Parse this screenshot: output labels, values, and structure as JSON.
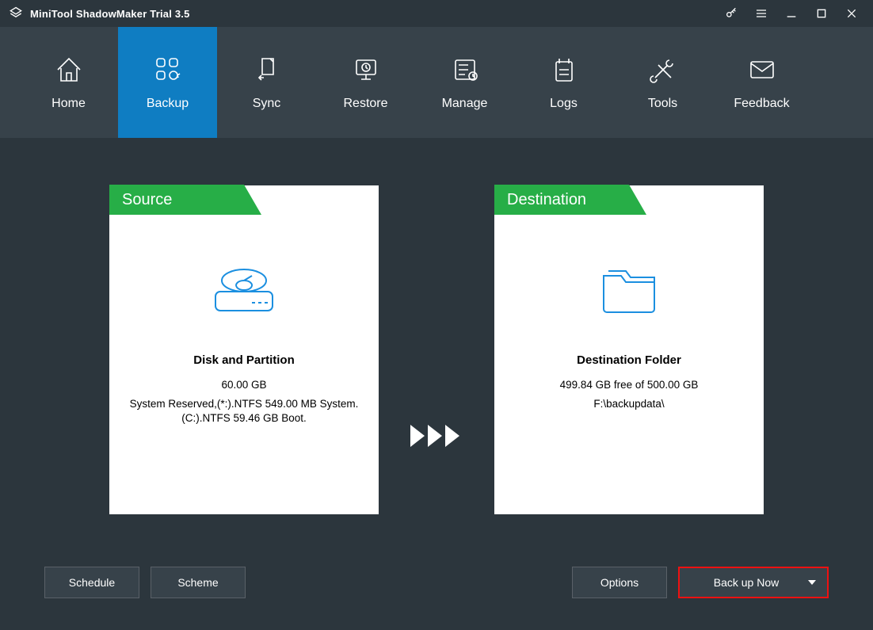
{
  "app_title": "MiniTool ShadowMaker Trial 3.5",
  "nav": [
    {
      "label": "Home"
    },
    {
      "label": "Backup"
    },
    {
      "label": "Sync"
    },
    {
      "label": "Restore"
    },
    {
      "label": "Manage"
    },
    {
      "label": "Logs"
    },
    {
      "label": "Tools"
    },
    {
      "label": "Feedback"
    }
  ],
  "source": {
    "tab": "Source",
    "title": "Disk and Partition",
    "size": "60.00 GB",
    "details": "System Reserved,(*:).NTFS 549.00 MB System. (C:).NTFS 59.46 GB Boot."
  },
  "destination": {
    "tab": "Destination",
    "title": "Destination Folder",
    "free": "499.84 GB free of 500.00 GB",
    "path": "F:\\backupdata\\"
  },
  "buttons": {
    "schedule": "Schedule",
    "scheme": "Scheme",
    "options": "Options",
    "backup_now": "Back up Now"
  }
}
